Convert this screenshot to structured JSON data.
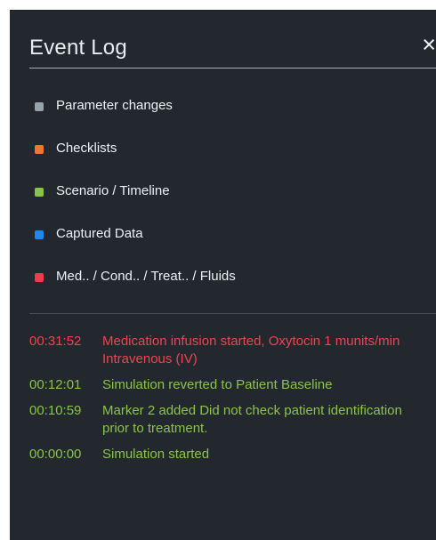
{
  "panel": {
    "title": "Event Log",
    "close_icon": "×"
  },
  "legend": [
    {
      "label": "Parameter changes",
      "color": "#98a2aa"
    },
    {
      "label": "Checklists",
      "color": "#f0782e"
    },
    {
      "label": "Scenario / Timeline",
      "color": "#8bc34a"
    },
    {
      "label": "Captured Data",
      "color": "#1e88f0"
    },
    {
      "label": "Med.. / Cond.. / Treat.. / Fluids",
      "color": "#ef3b4b"
    }
  ],
  "log": [
    {
      "time": "00:31:52",
      "text": "Medication infusion started, Oxytocin 1 munits/min Intravenous (IV)",
      "color": "#f0434f"
    },
    {
      "time": "00:12:01",
      "text": "Simulation reverted to Patient Baseline",
      "color": "#8bc34a"
    },
    {
      "time": "00:10:59",
      "text": "Marker 2 added Did not check patient identification prior to treatment.",
      "color": "#8bc34a"
    },
    {
      "time": "00:00:00",
      "text": "Simulation started",
      "color": "#8bc34a"
    }
  ]
}
